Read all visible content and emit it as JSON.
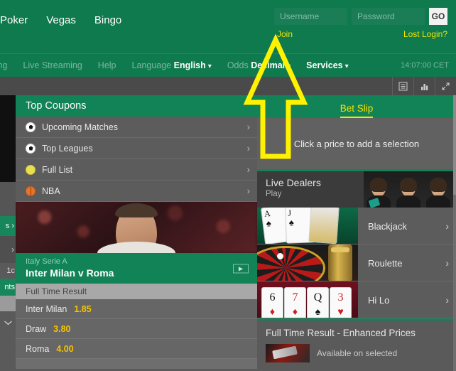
{
  "header": {
    "main_nav": [
      {
        "label": "Poker"
      },
      {
        "label": "Vegas"
      },
      {
        "label": "Bingo"
      }
    ],
    "login": {
      "username_placeholder": "Username",
      "username_value": "",
      "password_placeholder": "Password",
      "password_value": "",
      "go_label": "GO",
      "join_label": "Join",
      "lost_login_label": "Lost Login?"
    },
    "sub_nav": {
      "gambling_label": "bling",
      "live_streaming_label": "Live Streaming",
      "help_label": "Help",
      "language_label": "Language",
      "language_value": "English",
      "odds_label": "Odds",
      "odds_value": "Decimal",
      "services_label": "Services",
      "clock": "14:07:00 CET"
    }
  },
  "toolbar": {
    "icons": [
      {
        "name": "layout-icon",
        "glyph": "▤"
      },
      {
        "name": "bar-chart-icon",
        "glyph": "ᴵ"
      },
      {
        "name": "expand-icon",
        "glyph": "⤢"
      }
    ]
  },
  "left_strip": {
    "green_item_1": "s",
    "gray_item_chevron": "›",
    "text_item": "1c",
    "green_item_2": "nts",
    "chevron_down": "⌄"
  },
  "coupons": {
    "title": "Top Coupons",
    "items": [
      {
        "label": "Upcoming Matches",
        "icon": "soccer-ball-icon",
        "chevron": "›"
      },
      {
        "label": "Top Leagues",
        "icon": "soccer-ball-icon",
        "chevron": "›"
      },
      {
        "label": "Full List",
        "icon": "tennis-ball-icon",
        "chevron": "›"
      },
      {
        "label": "NBA",
        "icon": "basketball-icon",
        "chevron": "›"
      }
    ]
  },
  "match": {
    "league": "Italy Serie A",
    "teams": "Inter Milan v Roma",
    "play_glyph": "▶",
    "market_title": "Full Time Result",
    "selections": [
      {
        "name": "Inter Milan",
        "price": "1.85"
      },
      {
        "name": "Draw",
        "price": "3.80"
      },
      {
        "name": "Roma",
        "price": "4.00"
      }
    ]
  },
  "betslip": {
    "tab_label": "Bet Slip",
    "empty_message": "Click a price to add a selection"
  },
  "live_dealers": {
    "title": "Live Dealers",
    "subtitle": "Play",
    "games": [
      {
        "label": "Blackjack",
        "art": "blackjack-cards",
        "chevron": "›"
      },
      {
        "label": "Roulette",
        "art": "roulette-wheel",
        "chevron": "›"
      },
      {
        "label": "Hi Lo",
        "art": "hilo-cards",
        "chevron": "›"
      }
    ],
    "blackjack_cards": [
      {
        "rank": "A",
        "suit": "♠"
      },
      {
        "rank": "J",
        "suit": "♠"
      }
    ],
    "hilo_cards": [
      {
        "rank": "6",
        "suit": "♦",
        "color": "red"
      },
      {
        "rank": "7",
        "suit": "♦",
        "color": "red"
      },
      {
        "rank": "Q",
        "suit": "♠",
        "color": "blk"
      },
      {
        "rank": "3",
        "suit": "♥",
        "color": "red"
      }
    ]
  },
  "enhanced_prices": {
    "title": "Full Time Result - Enhanced Prices",
    "subtitle": "Available on selected"
  },
  "annotation": {
    "type": "arrow-up",
    "color": "#FFF200",
    "points_at": "Join"
  },
  "colors": {
    "brand_green": "#0e7a4d",
    "panel_green": "#128257",
    "accent_yellow": "#f5e400",
    "odds_yellow": "#f5c400",
    "dark_toolbar": "#4a4a4a",
    "panel_gray": "#5c5c5c"
  }
}
